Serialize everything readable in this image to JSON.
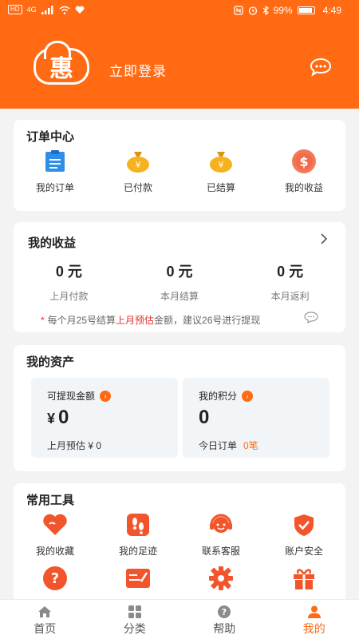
{
  "status_bar": {
    "left_chip": "HD",
    "signal": "4G",
    "battery": "99%",
    "time": "4:49"
  },
  "header": {
    "logo_text": "惠",
    "login_label": "立即登录",
    "message_icon": "chat-bubble-icon"
  },
  "orders": {
    "title": "订单中心",
    "items": [
      {
        "label": "我的订单",
        "icon": "clipboard-icon"
      },
      {
        "label": "已付款",
        "icon": "money-bag-icon"
      },
      {
        "label": "已结算",
        "icon": "money-bag-icon"
      },
      {
        "label": "我的收益",
        "icon": "dollar-coin-icon"
      }
    ]
  },
  "earnings": {
    "title": "我的收益",
    "stats": [
      {
        "value": "0 元",
        "label": "上月付款"
      },
      {
        "value": "0 元",
        "label": "本月结算"
      },
      {
        "value": "0 元",
        "label": "本月返利"
      }
    ],
    "notice_star": "*",
    "notice_pre": "每个月25号结算",
    "notice_highlight": "上月预估",
    "notice_post": "金额，建议26号进行提现"
  },
  "assets": {
    "title": "我的资产",
    "withdrawable": {
      "label": "可提现金额",
      "currency": "¥",
      "value": "0",
      "sub": "上月预估 ¥ 0"
    },
    "points": {
      "label": "我的积分",
      "value": "0",
      "sub": "今日订单",
      "sub_count": "0笔"
    }
  },
  "tools": {
    "title": "常用工具",
    "items": [
      {
        "label": "我的收藏",
        "icon": "heart-icon"
      },
      {
        "label": "我的足迹",
        "icon": "footprint-icon"
      },
      {
        "label": "联系客服",
        "icon": "headset-icon"
      },
      {
        "label": "账户安全",
        "icon": "shield-check-icon"
      }
    ],
    "items_row2": [
      {
        "icon": "question-icon"
      },
      {
        "icon": "edit-note-icon"
      },
      {
        "icon": "gear-icon"
      },
      {
        "icon": "gift-icon"
      }
    ]
  },
  "tabbar": {
    "tabs": [
      {
        "label": "首页",
        "icon": "home-icon"
      },
      {
        "label": "分类",
        "icon": "grid-icon"
      },
      {
        "label": "帮助",
        "icon": "help-icon"
      },
      {
        "label": "我的",
        "icon": "user-icon",
        "active": true
      }
    ]
  },
  "colors": {
    "accent": "#ff6a13",
    "highlight_red": "#e0322a",
    "blue": "#2f8fe8",
    "gold": "#f5b21f"
  }
}
